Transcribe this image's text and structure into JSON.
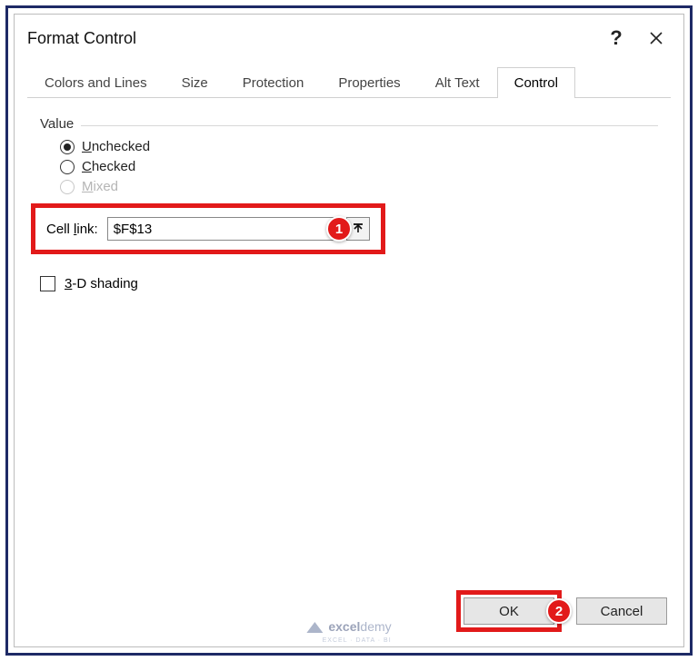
{
  "dialog": {
    "title": "Format Control",
    "help_btn": "?",
    "close_btn": "×"
  },
  "tabs": [
    {
      "label": "Colors and Lines",
      "active": false
    },
    {
      "label": "Size",
      "active": false
    },
    {
      "label": "Protection",
      "active": false
    },
    {
      "label": "Properties",
      "active": false
    },
    {
      "label": "Alt Text",
      "active": false
    },
    {
      "label": "Control",
      "active": true
    }
  ],
  "value_group": {
    "label": "Value",
    "options": {
      "unchecked": "Unchecked",
      "checked": "Checked",
      "mixed": "Mixed"
    },
    "selected": "unchecked",
    "mixed_enabled": false
  },
  "cell_link": {
    "label_prefix": "Cell ",
    "label_ul": "l",
    "label_suffix": "ink:",
    "value": "$F$13",
    "ref_btn": "collapse-dialog"
  },
  "shading": {
    "prefix": "",
    "ul": "3",
    "suffix": "-D shading",
    "checked": false
  },
  "buttons": {
    "ok": "OK",
    "cancel": "Cancel"
  },
  "annotations": {
    "badge1": "1",
    "badge2": "2"
  },
  "watermark": {
    "brand_a": "excel",
    "brand_b": "demy",
    "sub": "EXCEL · DATA · BI"
  }
}
